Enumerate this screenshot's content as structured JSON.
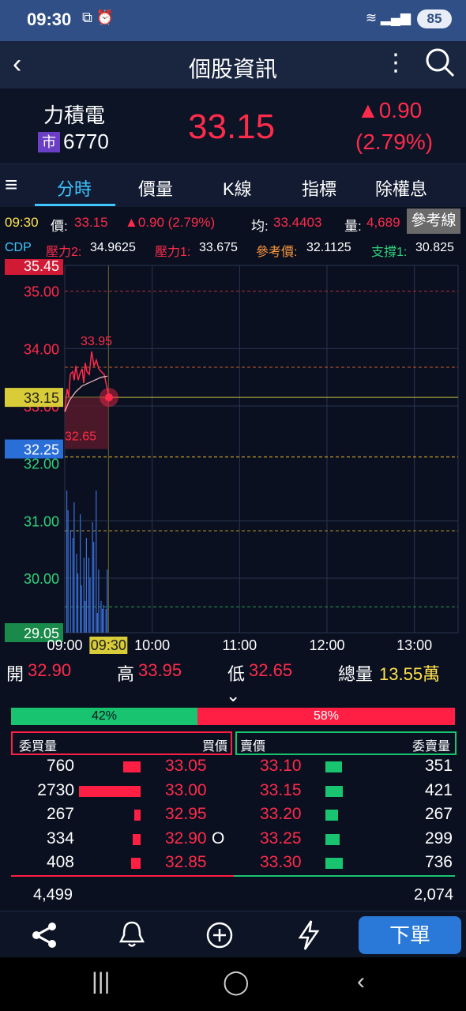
{
  "status": {
    "time": "09:30",
    "battery": "85"
  },
  "header": {
    "title": "個股資訊"
  },
  "stock": {
    "name": "力積電",
    "market": "市",
    "code": "6770",
    "price": "33.15",
    "change": "▲0.90",
    "change_pct": "(2.79%)"
  },
  "tabs": [
    "分時",
    "價量",
    "K線",
    "指標",
    "除權息"
  ],
  "info_line": {
    "time": "09:30",
    "price_label": "價:",
    "price": "33.15",
    "change": "▲0.90 (2.79%)",
    "avg_label": "均:",
    "avg": "33.4403",
    "vol_label": "量:",
    "vol": "4,689",
    "ref_button": "參考線"
  },
  "cdp_line": {
    "cdp": "CDP",
    "r2_label": "壓力2:",
    "r2": "34.9625",
    "r1_label": "壓力1:",
    "r1": "33.675",
    "ref_label": "參考價:",
    "ref": "32.1125",
    "s1_label": "支撐1:",
    "s1": "30.825"
  },
  "chart_data": {
    "type": "line",
    "x_ticks": [
      "09:00",
      "09:30",
      "10:00",
      "11:00",
      "12:00",
      "13:00"
    ],
    "y_ticks": [
      "35.00",
      "34.00",
      "33.00",
      "32.00",
      "31.00",
      "30.00"
    ],
    "ylim": [
      29.05,
      35.45
    ],
    "top_label": "35.45",
    "bottom_label": "29.05",
    "current_label": "33.15",
    "ref_label": "32.25",
    "high_label": "33.95",
    "low_label": "32.65",
    "colors": {
      "price": "#ff2b4a",
      "avg": "#e8b0b8",
      "volume": "#3a6fd8",
      "grid": "#2a3550"
    }
  },
  "ohlc": {
    "open_label": "開",
    "open": "32.90",
    "high_label": "高",
    "high": "33.95",
    "low_label": "低",
    "low": "32.65",
    "total_label": "總量",
    "total": "13.55萬"
  },
  "ratio": {
    "buy": "42%",
    "sell": "58%",
    "buy_fraction": 0.42
  },
  "book_headers": {
    "bid_qty": "委買量",
    "bid_price": "買價",
    "ask_price": "賣價",
    "ask_qty": "委賣量"
  },
  "book": [
    {
      "bq": "760",
      "bp": "33.05",
      "mark": "",
      "ap": "33.10",
      "aq": "351"
    },
    {
      "bq": "2730",
      "bp": "33.00",
      "mark": "",
      "ap": "33.15",
      "aq": "421"
    },
    {
      "bq": "267",
      "bp": "32.95",
      "mark": "",
      "ap": "33.20",
      "aq": "267"
    },
    {
      "bq": "334",
      "bp": "32.90",
      "mark": "O",
      "ap": "33.25",
      "aq": "299"
    },
    {
      "bq": "408",
      "bp": "32.85",
      "mark": "",
      "ap": "33.30",
      "aq": "736"
    }
  ],
  "totals": {
    "bid": "4,499",
    "ask": "2,074"
  },
  "bottom": {
    "order": "下單"
  }
}
